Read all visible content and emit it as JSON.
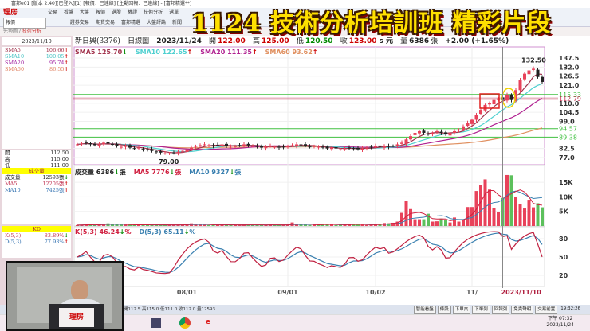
{
  "window": {
    "title": "富邦e01 [版本 2.40][已登入][1] [報價：已連線] [主動回報：已連線] - [富邦精選**]"
  },
  "banner": "1124 技術分析培訓班 精彩片段",
  "logo": "理房",
  "toolbar": {
    "menu": [
      "交易",
      "看盤",
      "大盤",
      "報價",
      "選股",
      "權證",
      "技術分析",
      "選單"
    ],
    "quick": [
      "證券交易",
      "期貨交易",
      "富邦精選",
      "大盤評論",
      "新聞"
    ],
    "combo": "報價"
  },
  "tabs": [
    "先勢圖",
    "技術分析"
  ],
  "left_panel": {
    "date": "2023/11/10",
    "sma": [
      {
        "label": "SMA5",
        "value": "106.66",
        "dir": "up",
        "color": "#a0304a"
      },
      {
        "label": "SMA10",
        "value": "100.05",
        "dir": "up",
        "color": "#40c0c0"
      },
      {
        "label": "SMA20",
        "value": "95.74",
        "dir": "up",
        "color": "#a020a0"
      },
      {
        "label": "SMA60",
        "value": "86.55",
        "dir": "up",
        "color": "#e08060"
      }
    ],
    "ohlc": [
      {
        "label": "開",
        "value": "112.50"
      },
      {
        "label": "高",
        "value": "115.00"
      },
      {
        "label": "低",
        "value": "111.00"
      },
      {
        "label": "收",
        "value": "112.00"
      }
    ],
    "vol_title": "成交量",
    "vol": [
      {
        "label": "成交量",
        "value": "12593張",
        "dir": "dn",
        "color": "#222"
      },
      {
        "label": "MA5",
        "value": "12205張",
        "dir": "up",
        "color": "#c03050"
      },
      {
        "label": "MA10",
        "value": "7425張",
        "dir": "up",
        "color": "#3070b0"
      }
    ],
    "kd_title": "KD",
    "kd": [
      {
        "label": "K(5,3)",
        "value": "83.89%",
        "dir": "dn",
        "color": "#c03050"
      },
      {
        "label": "D(5,3)",
        "value": "77.93%",
        "dir": "up",
        "color": "#3070b0"
      }
    ]
  },
  "quote": {
    "name": "新日興(3376)",
    "type": "日線圖",
    "date": "2023/11/24",
    "open_label": "開",
    "open": "122.00",
    "high_label": "高",
    "high": "125.00",
    "low_label": "低",
    "low": "120.50",
    "close_label": "收",
    "close": "123.00",
    "unit": "s 元",
    "vol_label": "量",
    "vol": "6386",
    "vol_unit": "張",
    "change": "+2.00 (+1.65%)"
  },
  "price_legend": [
    {
      "text": "SMA5 125.70",
      "dir": "dn",
      "color": "#a0304a"
    },
    {
      "text": "SMA10 122.65",
      "dir": "up",
      "color": "#50d0d0"
    },
    {
      "text": "SMA20 111.35",
      "dir": "up",
      "color": "#b02090"
    },
    {
      "text": "SMA60 93.62",
      "dir": "up",
      "color": "#e09060"
    }
  ],
  "vol_legend": [
    {
      "text": "成交量 6386",
      "dir": "dn",
      "unit": "張",
      "color": "#222"
    },
    {
      "text": "MA5 7776",
      "dir": "dn",
      "unit": "張",
      "color": "#d02040"
    },
    {
      "text": "MA10 9327",
      "dir": "dn",
      "unit": "張",
      "color": "#3a80b0"
    }
  ],
  "kd_legend": [
    {
      "text": "K(5,3) 46.24",
      "dir": "dn",
      "unit": "%",
      "color": "#d02040"
    },
    {
      "text": "D(5,3) 65.11",
      "dir": "dn",
      "unit": "%",
      "color": "#3a80b0"
    }
  ],
  "price_axis": [
    "137.5",
    "132.0",
    "126.5",
    "121.0",
    "110.0",
    "104.5",
    "99.0",
    "82.5",
    "77.0"
  ],
  "price_axis_values": [
    137.5,
    132,
    126.5,
    121,
    110,
    104.5,
    99,
    82.5,
    77
  ],
  "price_marks": [
    {
      "label": "115.33",
      "value": 115.33,
      "color": "#40c040"
    },
    {
      "label": "112.79",
      "value": 112.79,
      "color": "#c03050"
    },
    {
      "label": "94.57",
      "value": 94.57,
      "color": "#40c040"
    },
    {
      "label": "89.38",
      "value": 89.38,
      "color": "#40c040"
    }
  ],
  "high_label": "132.50",
  "low_label": "79.00",
  "vol_axis": [
    "15K",
    "10K",
    "5K"
  ],
  "vol_axis_values": [
    15,
    10,
    5
  ],
  "kd_axis": [
    "80",
    "50",
    "20"
  ],
  "kd_axis_values": [
    80,
    50,
    20
  ],
  "date_axis": [
    {
      "label": "08/01",
      "index": 25
    },
    {
      "label": "09/01",
      "index": 48
    },
    {
      "label": "10/02",
      "index": 68
    },
    {
      "label": "11/",
      "index": 90
    }
  ],
  "cursor_date": "2023/11/10",
  "cursor_index": 97,
  "chart_data": {
    "type": "candlestick",
    "closes": [
      85,
      85.5,
      86,
      85,
      84.5,
      85,
      86,
      85.5,
      85,
      84,
      83.5,
      84,
      83,
      82.5,
      83,
      82,
      81.5,
      81,
      80.5,
      80,
      79.5,
      79.5,
      80,
      80.5,
      81,
      82,
      83,
      84,
      84.5,
      85,
      84.5,
      84,
      84.5,
      85,
      84,
      83.5,
      84,
      84.5,
      85,
      84.5,
      84,
      83.5,
      83,
      83.5,
      84,
      83.5,
      83,
      83.5,
      84,
      84.5,
      85,
      84.5,
      84,
      83.5,
      84,
      83.5,
      83,
      82.5,
      83,
      82.5,
      82,
      82.5,
      83,
      82.5,
      82,
      82.5,
      83,
      83.5,
      84,
      83.5,
      84,
      83.5,
      84,
      85,
      86,
      88,
      90,
      92,
      93,
      92,
      91,
      92,
      93,
      92,
      91,
      92,
      93,
      94,
      96,
      98,
      100,
      103,
      106,
      109,
      110,
      112,
      113,
      112,
      115,
      112,
      118,
      124,
      128,
      130,
      131,
      126,
      123
    ],
    "volume_k": [
      0.3,
      0.4,
      0.5,
      0.4,
      0.3,
      0.6,
      0.8,
      0.9,
      0.6,
      0.5,
      0.4,
      0.5,
      0.4,
      0.3,
      0.4,
      0.5,
      0.4,
      0.3,
      0.3,
      0.4,
      0.5,
      0.4,
      0.3,
      0.3,
      0.4,
      0.8,
      0.9,
      0.6,
      0.5,
      0.4,
      0.3,
      0.3,
      0.4,
      0.5,
      0.4,
      0.3,
      0.3,
      0.4,
      0.5,
      0.4,
      0.3,
      0.3,
      0.4,
      0.3,
      0.5,
      0.4,
      0.3,
      0.3,
      0.4,
      1.2,
      0.8,
      0.5,
      0.4,
      0.3,
      0.4,
      0.5,
      0.8,
      0.6,
      0.4,
      0.3,
      0.4,
      0.5,
      0.6,
      0.8,
      0.5,
      0.4,
      0.3,
      0.4,
      0.6,
      0.8,
      1.0,
      0.9,
      1.1,
      1.5,
      4.5,
      8.5,
      5.8,
      2.3,
      2.3,
      2.3,
      4.2,
      1.5,
      1.6,
      2.5,
      2.1,
      1.2,
      2.9,
      1.5,
      2.3,
      6.5,
      6.5,
      12,
      14,
      16,
      12.5,
      6.2,
      4.8,
      9.6,
      17.5,
      17.4,
      10,
      7.4,
      6,
      9,
      6.4,
      7.8,
      6.4
    ],
    "ylim": [
      77,
      137.5
    ]
  },
  "status": {
    "text": "開112.5 高115.0 低111.0 收112.0 量12593",
    "buttons": [
      "智能看盤",
      "條股",
      "下單夾",
      "下單列",
      "回報列",
      "免責聲明",
      "交易前置"
    ],
    "time": "19:32:26"
  },
  "clock": {
    "time": "下午 07:32",
    "date": "2023/11/24"
  },
  "colors": {
    "up": "#e8425a",
    "down": "#5cc05c",
    "bg": "#ffffff"
  }
}
